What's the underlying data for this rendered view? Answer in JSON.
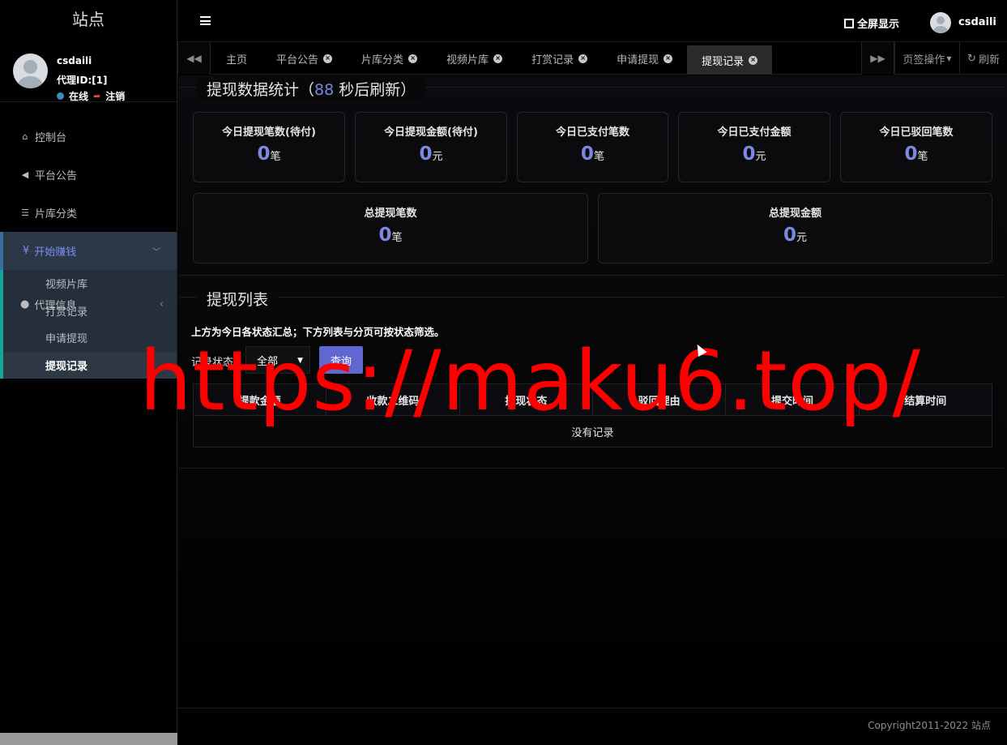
{
  "brand": "站点",
  "user": {
    "name": "csdaili",
    "agent_id": "代理ID:[1]",
    "online": "在线",
    "logout": "注销"
  },
  "menu": {
    "dashboard": "控制台",
    "announce": "平台公告",
    "library": "片库分类",
    "earn": "开始赚钱",
    "earn_icon": "¥",
    "sub": [
      "视频片库",
      "打赏记录",
      "申请提现",
      "提现记录"
    ],
    "agent": "代理信息"
  },
  "header": {
    "fullscreen": "全屏显示",
    "user": "csdaili"
  },
  "tabs": {
    "items": [
      "主页",
      "平台公告",
      "片库分类",
      "视频片库",
      "打赏记录",
      "申请提现",
      "提现记录"
    ],
    "ops": "页签操作",
    "refresh": "刷新"
  },
  "stats": {
    "legend_prefix": "提现数据统计（",
    "countdown": "88",
    "legend_suffix": " 秒后刷新）",
    "cards": [
      {
        "label": "今日提现笔数(待付)",
        "value": "0",
        "unit": "笔"
      },
      {
        "label": "今日提现金额(待付)",
        "value": "0",
        "unit": "元"
      },
      {
        "label": "今日已支付笔数",
        "value": "0",
        "unit": "笔"
      },
      {
        "label": "今日已支付金额",
        "value": "0",
        "unit": "元"
      },
      {
        "label": "今日已驳回笔数",
        "value": "0",
        "unit": "笔"
      },
      {
        "label": "总提现笔数",
        "value": "0",
        "unit": "笔"
      },
      {
        "label": "总提现金额",
        "value": "0",
        "unit": "元"
      }
    ]
  },
  "list": {
    "legend": "提现列表",
    "hint": "上方为今日各状态汇总；下方列表与分页可按状态筛选。",
    "filter_label": "记录状态",
    "filter_value": "全部",
    "query": "查询",
    "columns": [
      "提款金额",
      "收款二维码",
      "提现状态",
      "驳回理由",
      "提交时间",
      "结算时间"
    ],
    "empty": "没有记录"
  },
  "footer": "Copyright2011-2022 站点",
  "watermark": "https://maku6.top/",
  "colors": {
    "accent": "#7b87e0",
    "button": "#6266d1",
    "watermark": "#ff0000"
  }
}
